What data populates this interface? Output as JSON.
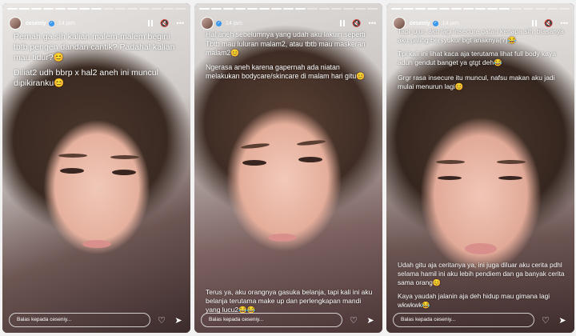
{
  "stories": [
    {
      "username": "ceseniy",
      "time": "14 jam",
      "progress": [
        true,
        true,
        true,
        true,
        true,
        true,
        true,
        true,
        false,
        false,
        false,
        false,
        false,
        false,
        false
      ],
      "top_text": [
        "Pernah ga sih kalian malem-malem begini tbtb pengen dandan cantik? Padahal kalian mau tidur?😊",
        "Diliat2 udh bbrp x hal2 aneh ini muncul dipikiranku😊"
      ],
      "bottom_text": [],
      "reply_placeholder": "Balas kepada ceseniy..."
    },
    {
      "username": "ceseniy",
      "time": "14 jam",
      "progress": [
        true,
        true,
        true,
        true,
        true,
        true,
        true,
        true,
        true,
        false,
        false,
        false,
        false,
        false,
        false
      ],
      "top_text": [
        "Hal aneh sebelumnya yang udah aku lakuin seperti Tbtb mau luluran malam2, atau tbtb mau maskeran malam2😊",
        "Ngerasa aneh karena gapernah ada niatan melakukan bodycare/skincare di malam hari gitu😊"
      ],
      "bottom_text": [
        "Terus ya, aku orangnya gasuka belanja, tapi kali ini aku belanja terutama make up dan perlengkapan mandi yang lucu2😂😂"
      ],
      "reply_placeholder": "Balas kepada ceseniy..."
    },
    {
      "username": "ceseniy",
      "time": "14 jam",
      "progress": [
        true,
        true,
        true,
        true,
        true,
        true,
        true,
        true,
        true,
        true,
        false,
        false,
        false,
        false,
        false
      ],
      "top_text": [
        "Tapi jujur, aku lagi insecure gatau kenapa sih, biasanya aku paling bersyukur bgt anaknya(?)😂",
        "Tpi kali ini lihat kaca aja terutama lihat full body kaya aduh gendut banget ya gtgt deh😂",
        "Grgr rasa insecure itu muncul, nafsu makan aku jadi mulai menurun lagi😊"
      ],
      "bottom_text": [
        "Udah gitu aja ceritanya ya, ini juga diluar aku cerita pdhl selama hamil ini aku lebih pendiem dan ga banyak cerita sama orang😊",
        "Kaya yaudah jalanin aja deh hidup mau gimana lagi wkwkwk😂"
      ],
      "reply_placeholder": "Balas kepada ceseniy..."
    }
  ],
  "icons": {
    "pause": "pause-icon",
    "mute": "speaker-mute-icon",
    "more": "more-icon",
    "like": "heart-icon",
    "share": "send-icon"
  }
}
